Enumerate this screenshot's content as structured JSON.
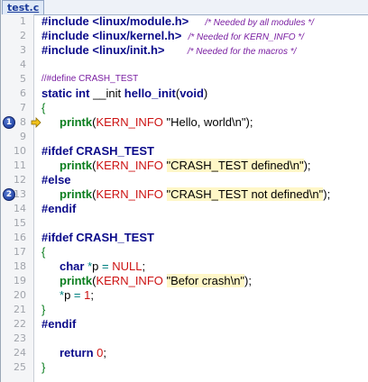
{
  "tab": {
    "label": "test.c"
  },
  "breakpoints": [
    {
      "number": "1",
      "line": 8
    },
    {
      "number": "2",
      "line": 13
    }
  ],
  "execution_arrow": {
    "line": 8,
    "icon": "current-line-arrow-icon",
    "color": "#f2c21a"
  },
  "colors": {
    "keyword": "#0a0a8a",
    "function": "#0b7e1f",
    "macro": "#cc1111",
    "comment": "#7a1fa2",
    "string_highlight": "#fff7c7",
    "breakpoint": "#2446a6"
  },
  "lines": [
    {
      "n": "1",
      "indent": false,
      "tokens": [
        {
          "t": "#include <linux/module.h>",
          "c": "pp"
        },
        {
          "t": "     ",
          "c": ""
        },
        {
          "t": "/* Needed by all modules */",
          "c": "cmt"
        }
      ]
    },
    {
      "n": "2",
      "indent": false,
      "tokens": [
        {
          "t": "#include <linux/kernel.h>",
          "c": "pp"
        },
        {
          "t": "  ",
          "c": ""
        },
        {
          "t": "/* Needed for KERN_INFO */",
          "c": "cmt"
        }
      ]
    },
    {
      "n": "3",
      "indent": false,
      "tokens": [
        {
          "t": "#include <linux/init.h>",
          "c": "pp"
        },
        {
          "t": "       ",
          "c": ""
        },
        {
          "t": "/* Needed for the macros */",
          "c": "cmt"
        }
      ]
    },
    {
      "n": "4",
      "indent": false,
      "tokens": []
    },
    {
      "n": "5",
      "indent": false,
      "tokens": [
        {
          "t": "//#define CRASH_TEST",
          "c": "cmt-line"
        }
      ]
    },
    {
      "n": "6",
      "indent": false,
      "tokens": [
        {
          "t": "static int ",
          "c": "kw"
        },
        {
          "t": "__init ",
          "c": "plain"
        },
        {
          "t": "hello_init",
          "c": "kw"
        },
        {
          "t": "(",
          "c": "plain"
        },
        {
          "t": "void",
          "c": "kw"
        },
        {
          "t": ")",
          "c": "plain"
        }
      ]
    },
    {
      "n": "7",
      "indent": false,
      "tokens": [
        {
          "t": "{",
          "c": "brace"
        }
      ]
    },
    {
      "n": "8",
      "indent": true,
      "tokens": [
        {
          "t": "printk",
          "c": "fn"
        },
        {
          "t": "(",
          "c": "plain"
        },
        {
          "t": "KERN_INFO",
          "c": "mac"
        },
        {
          "t": " \"Hello, world\\n\"",
          "c": "plain"
        },
        {
          "t": ");",
          "c": "plain"
        }
      ]
    },
    {
      "n": "9",
      "indent": false,
      "tokens": []
    },
    {
      "n": "10",
      "indent": false,
      "tokens": [
        {
          "t": "#ifdef CRASH_TEST",
          "c": "pp"
        }
      ]
    },
    {
      "n": "11",
      "indent": true,
      "tokens": [
        {
          "t": "printk",
          "c": "fn"
        },
        {
          "t": "(",
          "c": "plain"
        },
        {
          "t": "KERN_INFO",
          "c": "mac"
        },
        {
          "t": " ",
          "c": "plain"
        },
        {
          "t": "\"CRASH_TEST defined\\n\"",
          "c": "str"
        },
        {
          "t": ");",
          "c": "plain"
        }
      ]
    },
    {
      "n": "12",
      "indent": false,
      "tokens": [
        {
          "t": "#else",
          "c": "pp"
        }
      ]
    },
    {
      "n": "13",
      "indent": true,
      "tokens": [
        {
          "t": "printk",
          "c": "fn"
        },
        {
          "t": "(",
          "c": "plain"
        },
        {
          "t": "KERN_INFO",
          "c": "mac"
        },
        {
          "t": " ",
          "c": "plain"
        },
        {
          "t": "\"CRASH_TEST not defined\\n\"",
          "c": "str"
        },
        {
          "t": ");",
          "c": "plain"
        }
      ]
    },
    {
      "n": "14",
      "indent": false,
      "tokens": [
        {
          "t": "#endif",
          "c": "pp"
        }
      ]
    },
    {
      "n": "15",
      "indent": false,
      "tokens": []
    },
    {
      "n": "16",
      "indent": false,
      "tokens": [
        {
          "t": "#ifdef CRASH_TEST",
          "c": "pp"
        }
      ]
    },
    {
      "n": "17",
      "indent": false,
      "tokens": [
        {
          "t": "{",
          "c": "brace"
        }
      ]
    },
    {
      "n": "18",
      "indent": true,
      "tokens": [
        {
          "t": "char ",
          "c": "kw"
        },
        {
          "t": "*",
          "c": "op"
        },
        {
          "t": "p ",
          "c": "plain"
        },
        {
          "t": "=",
          "c": "op"
        },
        {
          "t": " ",
          "c": "plain"
        },
        {
          "t": "NULL",
          "c": "mac"
        },
        {
          "t": ";",
          "c": "plain"
        }
      ]
    },
    {
      "n": "19",
      "indent": true,
      "tokens": [
        {
          "t": "printk",
          "c": "fn"
        },
        {
          "t": "(",
          "c": "plain"
        },
        {
          "t": "KERN_INFO",
          "c": "mac"
        },
        {
          "t": " ",
          "c": "plain"
        },
        {
          "t": "\"Befor crash\\n\"",
          "c": "str"
        },
        {
          "t": ");",
          "c": "plain"
        }
      ]
    },
    {
      "n": "20",
      "indent": true,
      "tokens": [
        {
          "t": "*",
          "c": "op"
        },
        {
          "t": "p ",
          "c": "plain"
        },
        {
          "t": "=",
          "c": "op"
        },
        {
          "t": " ",
          "c": "plain"
        },
        {
          "t": "1",
          "c": "num"
        },
        {
          "t": ";",
          "c": "plain"
        }
      ]
    },
    {
      "n": "21",
      "indent": false,
      "tokens": [
        {
          "t": "}",
          "c": "brace"
        }
      ]
    },
    {
      "n": "22",
      "indent": false,
      "tokens": [
        {
          "t": "#endif",
          "c": "pp"
        }
      ]
    },
    {
      "n": "23",
      "indent": false,
      "tokens": []
    },
    {
      "n": "24",
      "indent": true,
      "tokens": [
        {
          "t": "return ",
          "c": "kw"
        },
        {
          "t": "0",
          "c": "num"
        },
        {
          "t": ";",
          "c": "plain"
        }
      ]
    },
    {
      "n": "25",
      "indent": false,
      "tokens": [
        {
          "t": "}",
          "c": "brace"
        }
      ]
    }
  ]
}
